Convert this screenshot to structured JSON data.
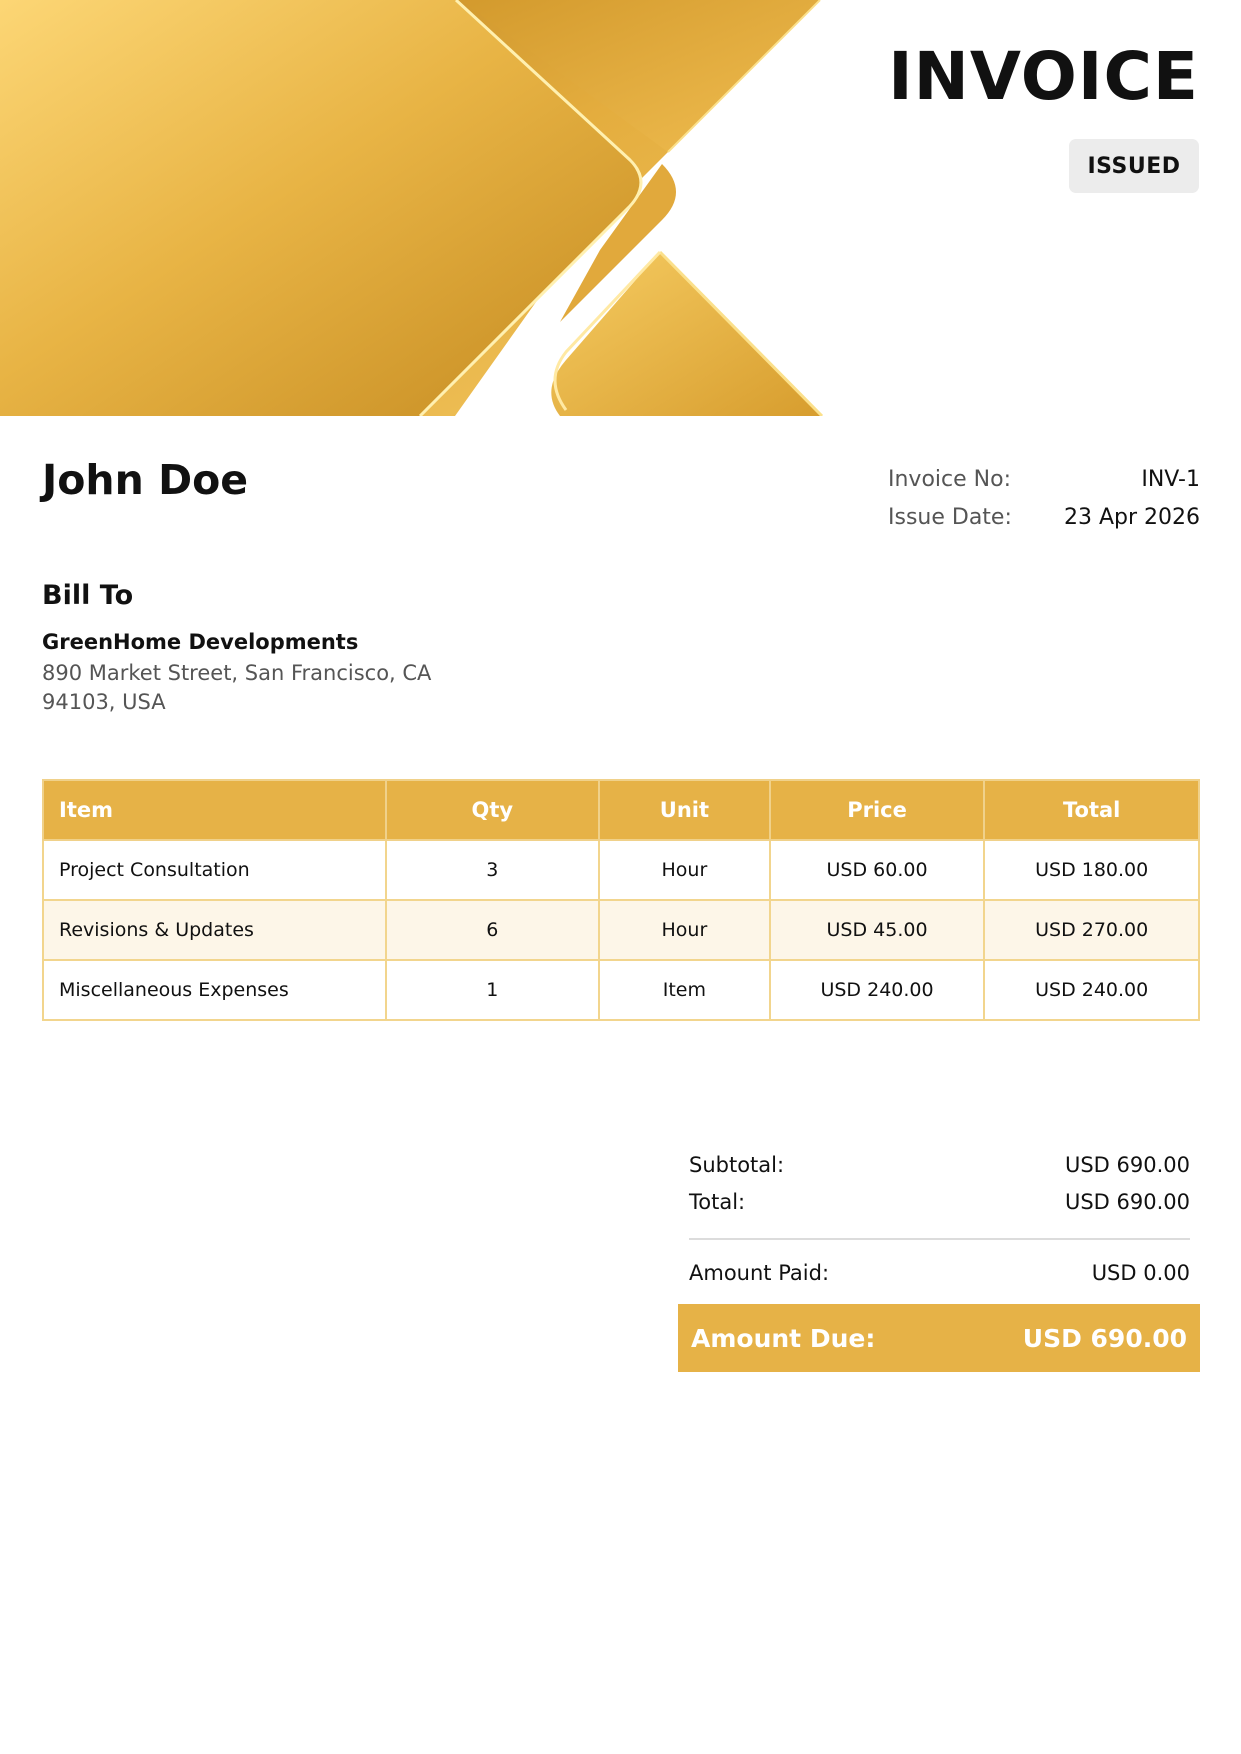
{
  "document": {
    "title": "INVOICE",
    "status": "ISSUED"
  },
  "sender": {
    "name": "John Doe"
  },
  "meta": {
    "invoice_no_label": "Invoice No:",
    "invoice_no": "INV-1",
    "issue_date_label": "Issue Date:",
    "issue_date": "23 Apr 2026"
  },
  "bill_to": {
    "heading": "Bill To",
    "company": "GreenHome Developments",
    "address": "890 Market Street, San Francisco, CA 94103, USA"
  },
  "table": {
    "headers": [
      "Item",
      "Qty",
      "Unit",
      "Price",
      "Total"
    ],
    "rows": [
      [
        "Project Consultation",
        "3",
        "Hour",
        "USD 60.00",
        "USD 180.00"
      ],
      [
        "Revisions & Updates",
        "6",
        "Hour",
        "USD 45.00",
        "USD 270.00"
      ],
      [
        "Miscellaneous Expenses",
        "1",
        "Item",
        "USD 240.00",
        "USD 240.00"
      ]
    ]
  },
  "summary": {
    "subtotal_label": "Subtotal:",
    "subtotal": "USD 690.00",
    "total_label": "Total:",
    "total": "USD 690.00",
    "paid_label": "Amount Paid:",
    "paid": "USD 0.00",
    "due_label": "Amount Due:",
    "due": "USD 690.00"
  },
  "colors": {
    "accent": "#e6b247",
    "row_alt": "#fdf6e8",
    "badge_bg": "#ececec"
  }
}
